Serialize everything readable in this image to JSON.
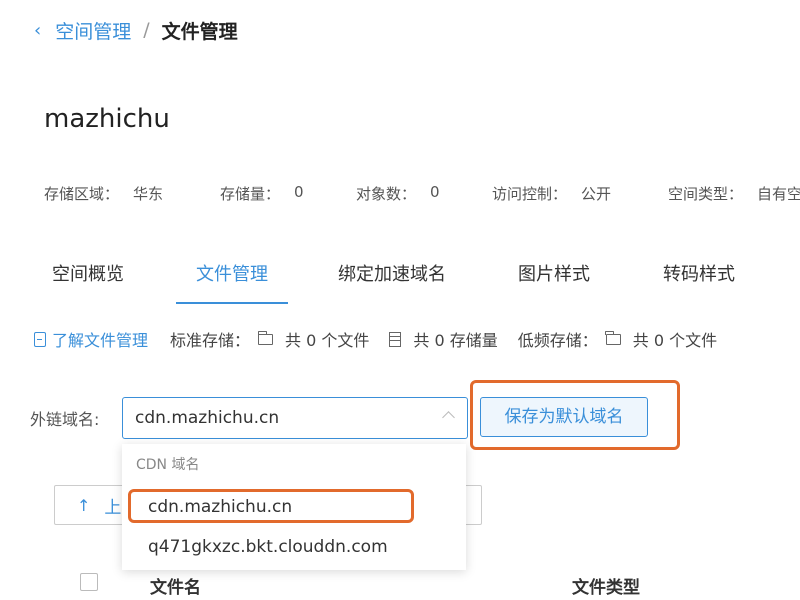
{
  "breadcrumb": {
    "back_icon": "‹",
    "parent": "空间管理",
    "separator": "/",
    "current": "文件管理"
  },
  "bucket": {
    "name": "mazhichu"
  },
  "meta": [
    {
      "label": "存储区域：",
      "value": "华东"
    },
    {
      "label": "存储量：",
      "value": "0"
    },
    {
      "label": "对象数：",
      "value": "0"
    },
    {
      "label": "访问控制：",
      "value": "公开"
    },
    {
      "label": "空间类型：",
      "value": "自有空"
    }
  ],
  "tabs": [
    {
      "label": "空间概览",
      "active": false
    },
    {
      "label": "文件管理",
      "active": true
    },
    {
      "label": "绑定加速域名",
      "active": false
    },
    {
      "label": "图片样式",
      "active": false
    },
    {
      "label": "转码样式",
      "active": false
    }
  ],
  "info": {
    "learn_link": "了解文件管理",
    "standard_label": "标准存储：",
    "standard_files": "共 0 个文件",
    "standard_size": "共 0 存储量",
    "low_freq_label": "低频存储：",
    "low_freq_files": "共 0 个文件"
  },
  "domain": {
    "label": "外链域名:",
    "selected": "cdn.mazhichu.cn",
    "save_button": "保存为默认域名",
    "dropdown_group": "CDN 域名",
    "options": [
      "cdn.mazhichu.cn",
      "q471gkxzc.bkt.clouddn.com"
    ]
  },
  "upload": {
    "icon": "↑",
    "label": "上"
  },
  "table": {
    "headers": [
      "文件名",
      "文件类型"
    ]
  },
  "colors": {
    "accent": "#3a8fd9",
    "highlight": "#e26a2c"
  }
}
